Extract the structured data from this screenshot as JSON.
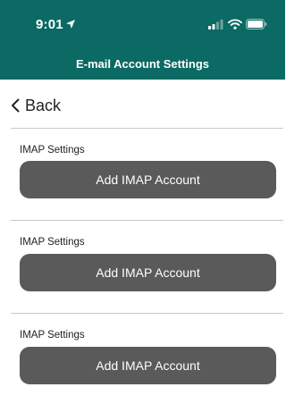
{
  "status_bar": {
    "time": "9:01"
  },
  "header": {
    "title": "E-mail Account Settings"
  },
  "nav": {
    "back_label": "Back"
  },
  "sections": [
    {
      "label": "IMAP Settings",
      "button_label": "Add IMAP Account"
    },
    {
      "label": "IMAP Settings",
      "button_label": "Add IMAP Account"
    },
    {
      "label": "IMAP Settings",
      "button_label": "Add IMAP Account"
    }
  ],
  "colors": {
    "header_bg": "#0b6a63",
    "button_bg": "#5a5a5a",
    "divider": "#c9c9c9"
  }
}
